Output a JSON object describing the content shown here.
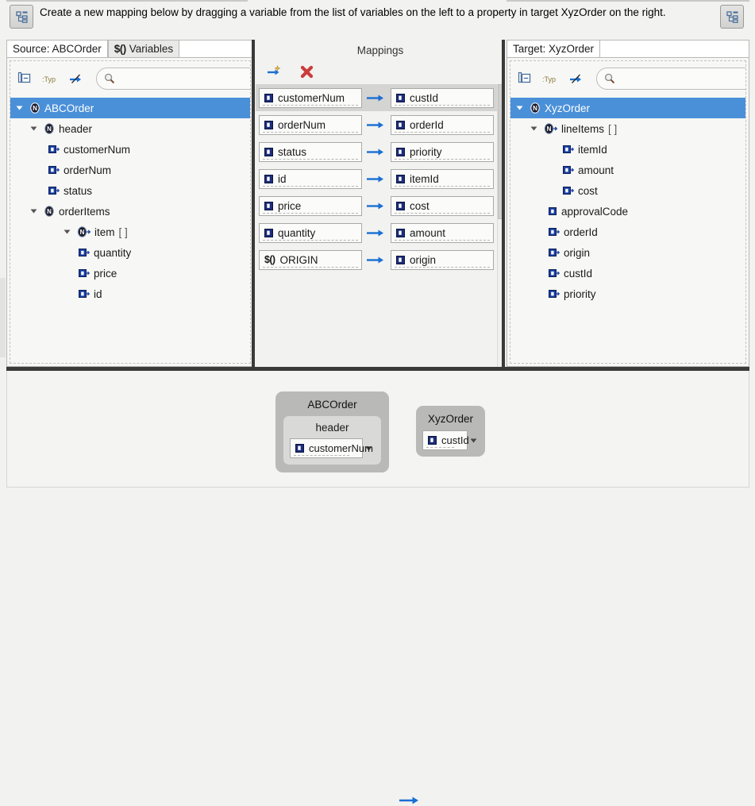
{
  "instruction": {
    "text": "Create a new mapping below by dragging a variable from the list of variables on the left to a property in target XyzOrder on the right.",
    "left_button_icon": "tree-hierarchy-icon",
    "right_button_icon": "tree-hierarchy-icon"
  },
  "source_panel": {
    "tabs": [
      {
        "label": "Source: ABCOrder",
        "active": true
      },
      {
        "label": "Variables",
        "prefix": "$()",
        "active": false
      }
    ],
    "toolbar": {
      "collapse_all_icon": "collapse-all-icon",
      "show_types_icon": "show-types-icon",
      "hide_links_icon": "hide-links-icon",
      "search_placeholder": "",
      "search_value": "",
      "search_icon": "search-icon"
    },
    "tree": [
      {
        "label": "ABCOrder",
        "icon": "node-icon",
        "indent": 0,
        "twisty": "open",
        "selected": true
      },
      {
        "label": "header",
        "icon": "node-icon",
        "indent": 1,
        "twisty": "open",
        "selected": false
      },
      {
        "label": "customerNum",
        "icon": "property-icon",
        "indent": 2,
        "twisty": "none",
        "selected": false
      },
      {
        "label": "orderNum",
        "icon": "property-icon",
        "indent": 2,
        "twisty": "none",
        "selected": false
      },
      {
        "label": "status",
        "icon": "property-icon",
        "indent": 2,
        "twisty": "none",
        "selected": false
      },
      {
        "label": "orderItems",
        "icon": "node-icon",
        "indent": 1,
        "twisty": "open",
        "selected": false
      },
      {
        "label": "item",
        "suffix": "[ ]",
        "icon": "node-array-icon",
        "indent": 2,
        "twisty": "open",
        "selected": false
      },
      {
        "label": "quantity",
        "icon": "property-icon",
        "indent": 3,
        "twisty": "none",
        "selected": false
      },
      {
        "label": "price",
        "icon": "property-icon",
        "indent": 3,
        "twisty": "none",
        "selected": false
      },
      {
        "label": "id",
        "icon": "property-icon",
        "indent": 3,
        "twisty": "none",
        "selected": false
      }
    ]
  },
  "mappings_panel": {
    "title": "Mappings",
    "toolbar": {
      "add_mapping_icon": "add-mapping-arrow-icon",
      "delete_mapping_icon": "delete-mapping-x-icon"
    },
    "arrow_icon": "mapping-arrow-icon",
    "rows": [
      {
        "source": "customerNum",
        "source_icon": "property-icon",
        "target": "custId",
        "target_icon": "property-icon",
        "selected": true
      },
      {
        "source": "orderNum",
        "source_icon": "property-icon",
        "target": "orderId",
        "target_icon": "property-icon",
        "selected": false
      },
      {
        "source": "status",
        "source_icon": "property-icon",
        "target": "priority",
        "target_icon": "property-icon",
        "selected": false
      },
      {
        "source": "id",
        "source_icon": "property-icon",
        "target": "itemId",
        "target_icon": "property-icon",
        "selected": false
      },
      {
        "source": "price",
        "source_icon": "property-icon",
        "target": "cost",
        "target_icon": "property-icon",
        "selected": false
      },
      {
        "source": "quantity",
        "source_icon": "property-icon",
        "target": "amount",
        "target_icon": "property-icon",
        "selected": false
      },
      {
        "source": "ORIGIN",
        "source_icon": "variable-icon",
        "source_prefix": "$()",
        "target": "origin",
        "target_icon": "property-icon",
        "selected": false
      }
    ]
  },
  "target_panel": {
    "tabs": [
      {
        "label": "Target: XyzOrder",
        "active": true
      }
    ],
    "toolbar": {
      "collapse_all_icon": "collapse-all-icon",
      "show_types_icon": "show-types-icon",
      "hide_links_icon": "hide-links-icon",
      "search_placeholder": "",
      "search_value": "",
      "search_icon": "search-icon",
      "clear_icon": "clear-search-icon"
    },
    "tree": [
      {
        "label": "XyzOrder",
        "icon": "node-icon",
        "indent": 0,
        "twisty": "open",
        "selected": true
      },
      {
        "label": "lineItems",
        "suffix": "[ ]",
        "icon": "node-array-icon",
        "indent": 1,
        "twisty": "open",
        "selected": false
      },
      {
        "label": "itemId",
        "icon": "property-icon",
        "indent": 2,
        "twisty": "none",
        "selected": false
      },
      {
        "label": "amount",
        "icon": "property-icon",
        "indent": 2,
        "twisty": "none",
        "selected": false
      },
      {
        "label": "cost",
        "icon": "property-icon",
        "indent": 2,
        "twisty": "none",
        "selected": false
      },
      {
        "label": "approvalCode",
        "icon": "property-plain-icon",
        "indent": 1,
        "twisty": "none",
        "selected": false
      },
      {
        "label": "orderId",
        "icon": "property-icon",
        "indent": 1,
        "twisty": "none",
        "selected": false
      },
      {
        "label": "origin",
        "icon": "property-icon",
        "indent": 1,
        "twisty": "none",
        "selected": false
      },
      {
        "label": "custId",
        "icon": "property-icon",
        "indent": 1,
        "twisty": "none",
        "selected": false
      },
      {
        "label": "priority",
        "icon": "property-icon",
        "indent": 1,
        "twisty": "none",
        "selected": false
      }
    ]
  },
  "diagram": {
    "source_node": {
      "title": "ABCOrder",
      "group_title": "header",
      "field_label": "customerNum",
      "field_icon": "property-icon",
      "dropdown_icon": "caret-down-icon"
    },
    "arrow_icon": "mapping-arrow-icon",
    "target_node": {
      "title": "XyzOrder",
      "field_label": "custId",
      "field_icon": "property-icon",
      "dropdown_icon": "caret-down-icon"
    }
  },
  "colors": {
    "selection_blue": "#4a90d9",
    "arrow_blue": "#1a6fd4",
    "delete_red": "#cc3b3b",
    "sash_dark": "#3a3a3a",
    "panel_bg": "#f2f2f0",
    "tree_bg": "#f7f7f5"
  }
}
